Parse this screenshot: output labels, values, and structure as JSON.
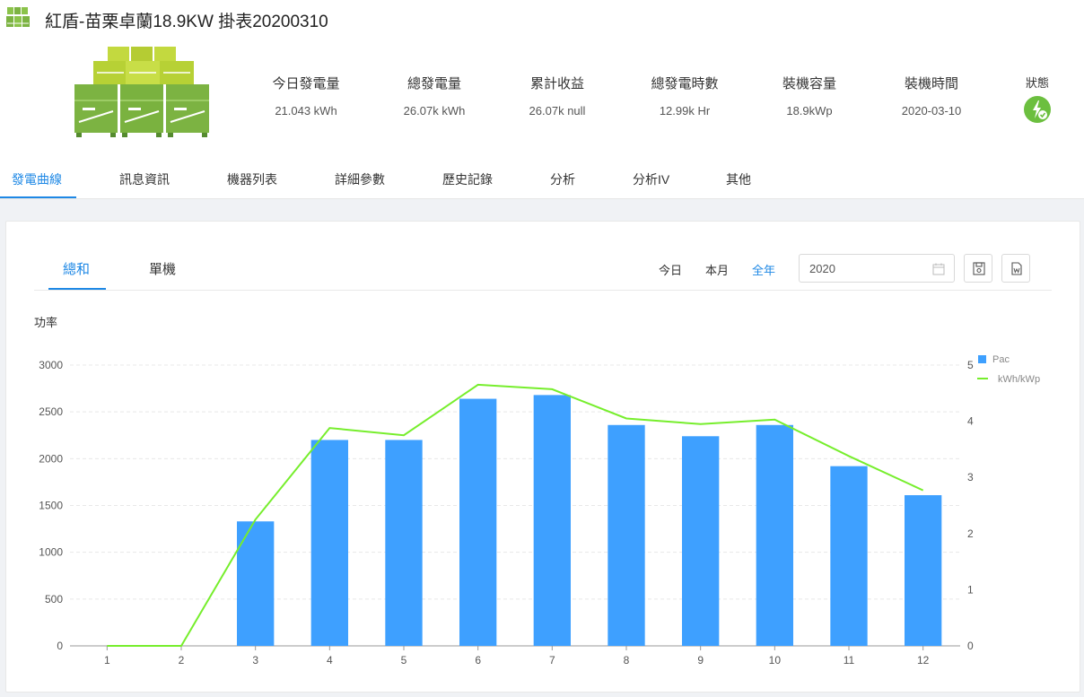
{
  "header": {
    "title": "紅盾-苗栗卓蘭18.9KW 掛表20200310",
    "app_icon": "solar-panel-icon"
  },
  "stats": [
    {
      "label": "今日發電量",
      "value": "21.043 kWh"
    },
    {
      "label": "總發電量",
      "value": "26.07k kWh"
    },
    {
      "label": "累計收益",
      "value": "26.07k null"
    },
    {
      "label": "總發電時數",
      "value": "12.99k Hr"
    },
    {
      "label": "裝機容量",
      "value": "18.9kWp"
    },
    {
      "label": "裝機時間",
      "value": "2020-03-10"
    }
  ],
  "status": {
    "label": "狀態",
    "icon": "power-status-icon",
    "color": "#6cbf3f"
  },
  "tabs": [
    "發電曲線",
    "訊息資訊",
    "機器列表",
    "詳細參數",
    "歷史記錄",
    "分析",
    "分析IV",
    "其他"
  ],
  "active_tab": "發電曲線",
  "subtabs": [
    "總和",
    "單機"
  ],
  "periods": [
    "今日",
    "本月",
    "全年"
  ],
  "active_period": "全年",
  "year_picker": {
    "value": "2020",
    "icon": "calendar-icon"
  },
  "actions": [
    {
      "icon": "save-icon"
    },
    {
      "icon": "export-word-icon"
    }
  ],
  "colors": {
    "accent": "#1e88e5",
    "bar": "#3ea0ff",
    "line": "#76ee2c",
    "status_green": "#6cbf3f"
  },
  "chart_data": {
    "type": "bar",
    "title": "功率",
    "categories": [
      "1",
      "2",
      "3",
      "4",
      "5",
      "6",
      "7",
      "8",
      "9",
      "10",
      "11",
      "12"
    ],
    "series": [
      {
        "name": "Pac",
        "type": "bar",
        "axis": "left",
        "values": [
          0,
          0,
          1330,
          2200,
          2200,
          2640,
          2680,
          2360,
          2240,
          2360,
          1920,
          1610
        ]
      },
      {
        "name": "kWh/kWp",
        "type": "line",
        "axis": "right",
        "values": [
          0,
          0,
          2.25,
          3.88,
          3.75,
          4.65,
          4.57,
          4.05,
          3.95,
          4.03,
          3.38,
          2.77
        ]
      }
    ],
    "y_left": {
      "min": 0,
      "max": 3000,
      "ticks": [
        0,
        500,
        1000,
        1500,
        2000,
        2500,
        3000
      ]
    },
    "y_right": {
      "min": 0,
      "max": 5,
      "ticks": [
        0,
        1,
        2,
        3,
        4,
        5
      ]
    },
    "grid": true,
    "legend": "top-right"
  }
}
